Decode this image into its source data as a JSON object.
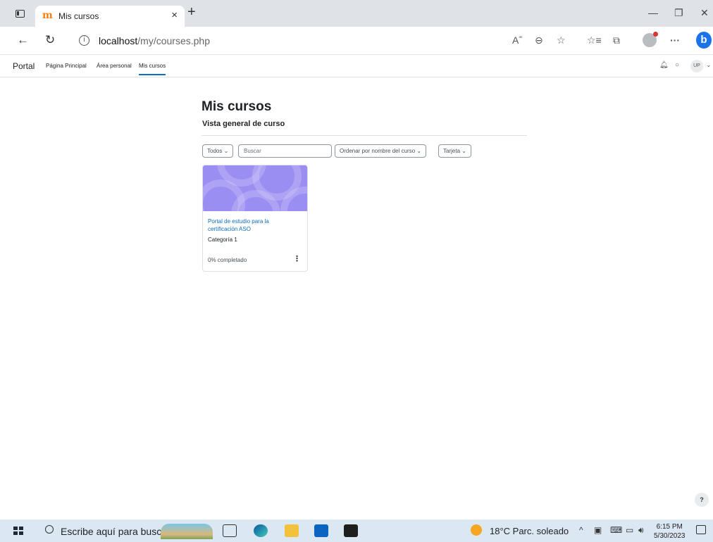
{
  "browser": {
    "tab_title": "Mis cursos",
    "tab_favicon": "moodle-icon",
    "url_host": "localhost",
    "url_path": "/my/courses.php",
    "window_controls": [
      "minimize-icon",
      "restore-icon",
      "close-icon"
    ]
  },
  "navbar": {
    "brand": "Portal",
    "links": [
      {
        "label": "Página Principal"
      },
      {
        "label": "Área personal"
      },
      {
        "label": "Mis cursos",
        "active": true
      }
    ],
    "avatar_initials": "UP"
  },
  "main": {
    "page_title": "Mis cursos",
    "block_title": "Vista general de curso",
    "filters": {
      "grouping": "Todos",
      "search_placeholder": "Buscar",
      "sort": "Ordenar por nombre del curso",
      "view": "Tarjeta"
    },
    "courses": [
      {
        "name": "Portal de estudio para la certificación ASO",
        "category": "Categoría 1",
        "progress_text": "0% completado",
        "image_color": "#9b8ef2"
      }
    ]
  },
  "help_label": "?",
  "taskbar": {
    "search_placeholder": "Escribe aquí para buscar",
    "weather": "18°C  Parc. soleado",
    "time": "6:15 PM",
    "date": "5/30/2023"
  },
  "colors": {
    "link": "#0f6cbf",
    "tabbar": "#dfe3e8",
    "taskbar": "#dbe7f3"
  }
}
